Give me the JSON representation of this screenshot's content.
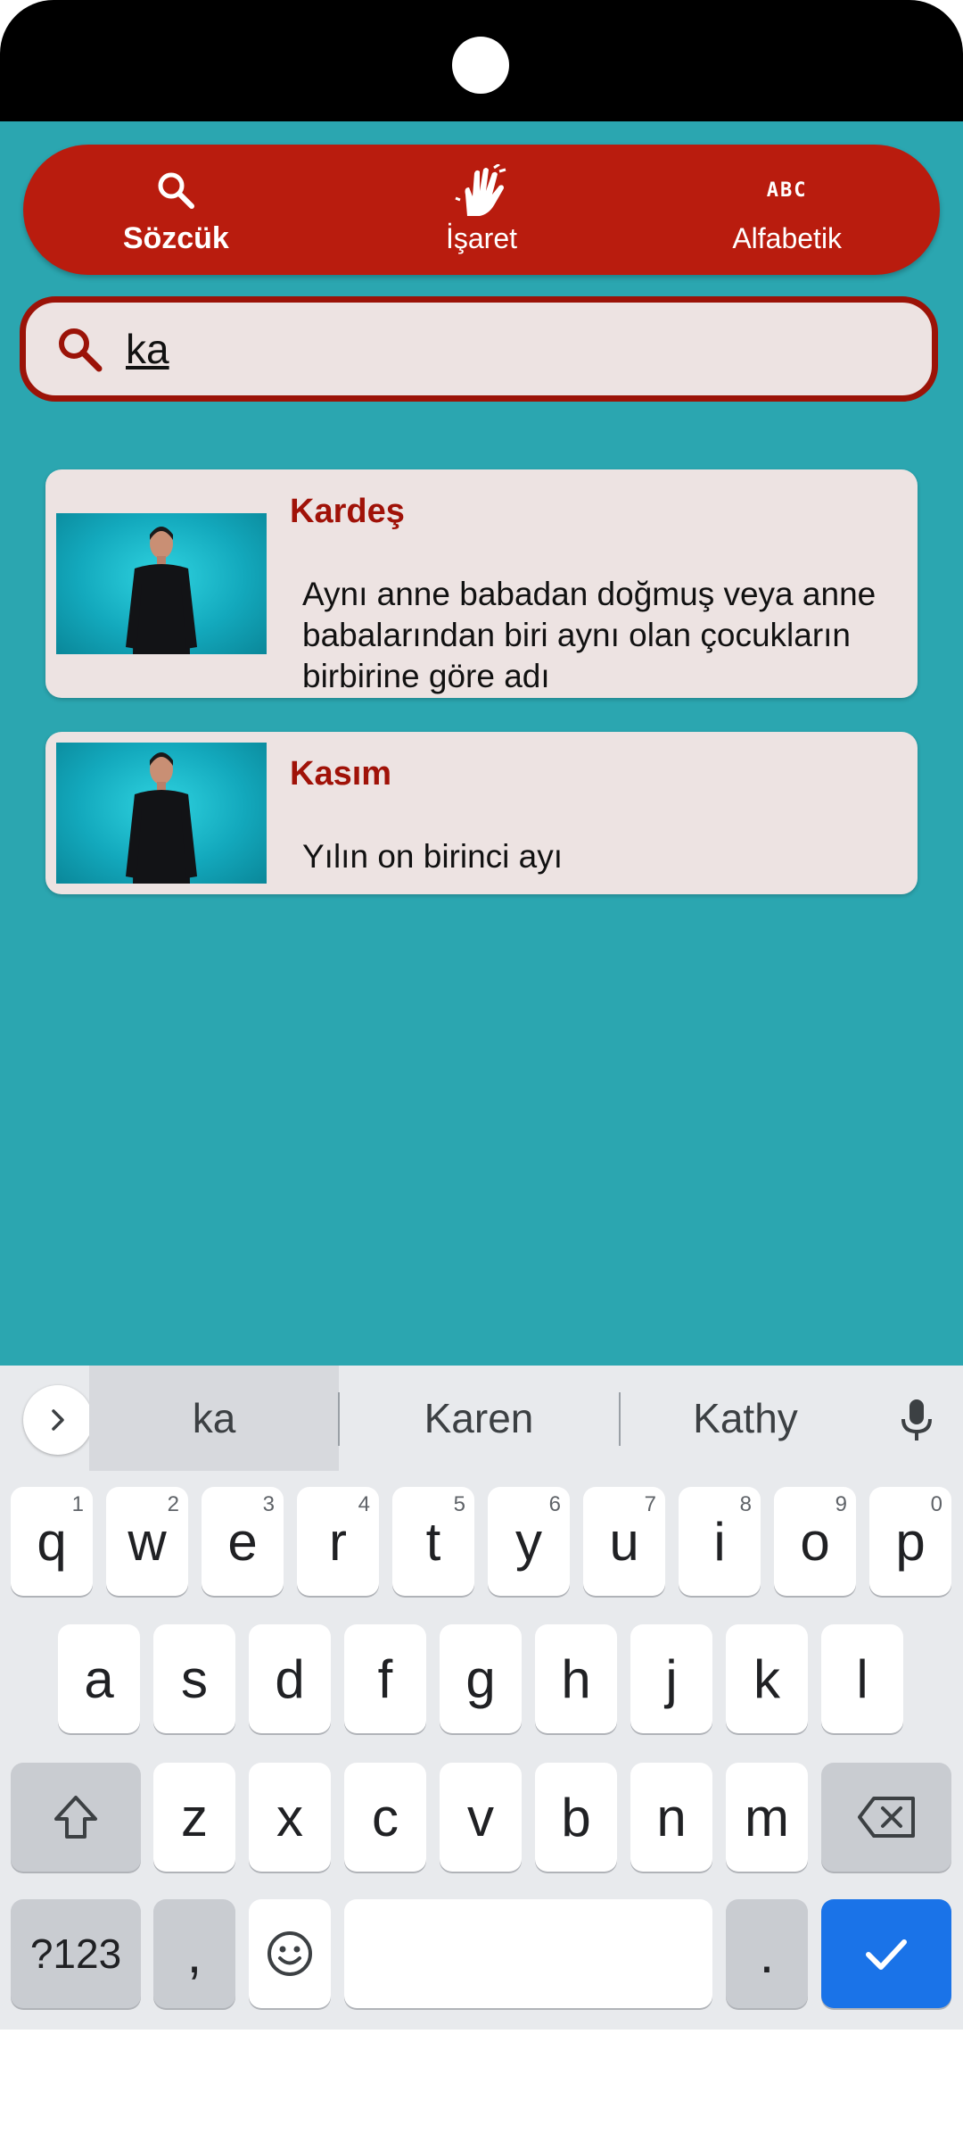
{
  "nav": {
    "tabs": [
      {
        "label": "Sözcük",
        "icon": "search-icon",
        "active": true
      },
      {
        "label": "İşaret",
        "icon": "hand-sign-icon",
        "active": false
      },
      {
        "label": "Alfabetik",
        "icon": "abc-icon",
        "active": false
      }
    ],
    "abc_text": "ABC"
  },
  "search": {
    "value": "ka",
    "placeholder": ""
  },
  "results": [
    {
      "title": "Kardeş",
      "description": "Aynı anne babadan doğmuş veya anne babalarından biri aynı olan çocukların birbirine göre adı"
    },
    {
      "title": "Kasım",
      "description": "Yılın on birinci ayı"
    }
  ],
  "keyboard": {
    "suggestions": [
      "ka",
      "Karen",
      "Kathy"
    ],
    "row1": [
      {
        "key": "q",
        "num": "1"
      },
      {
        "key": "w",
        "num": "2"
      },
      {
        "key": "e",
        "num": "3"
      },
      {
        "key": "r",
        "num": "4"
      },
      {
        "key": "t",
        "num": "5"
      },
      {
        "key": "y",
        "num": "6"
      },
      {
        "key": "u",
        "num": "7"
      },
      {
        "key": "i",
        "num": "8"
      },
      {
        "key": "o",
        "num": "9"
      },
      {
        "key": "p",
        "num": "0"
      }
    ],
    "row2": [
      "a",
      "s",
      "d",
      "f",
      "g",
      "h",
      "j",
      "k",
      "l"
    ],
    "row3": [
      "z",
      "x",
      "c",
      "v",
      "b",
      "n",
      "m"
    ],
    "symbols_label": "?123",
    "comma_label": ",",
    "period_label": "."
  },
  "colors": {
    "background": "#2ba6b0",
    "nav": "#b91c0e",
    "accent_text": "#a01208",
    "card": "#ede3e2",
    "enter_key": "#1a73e8"
  }
}
